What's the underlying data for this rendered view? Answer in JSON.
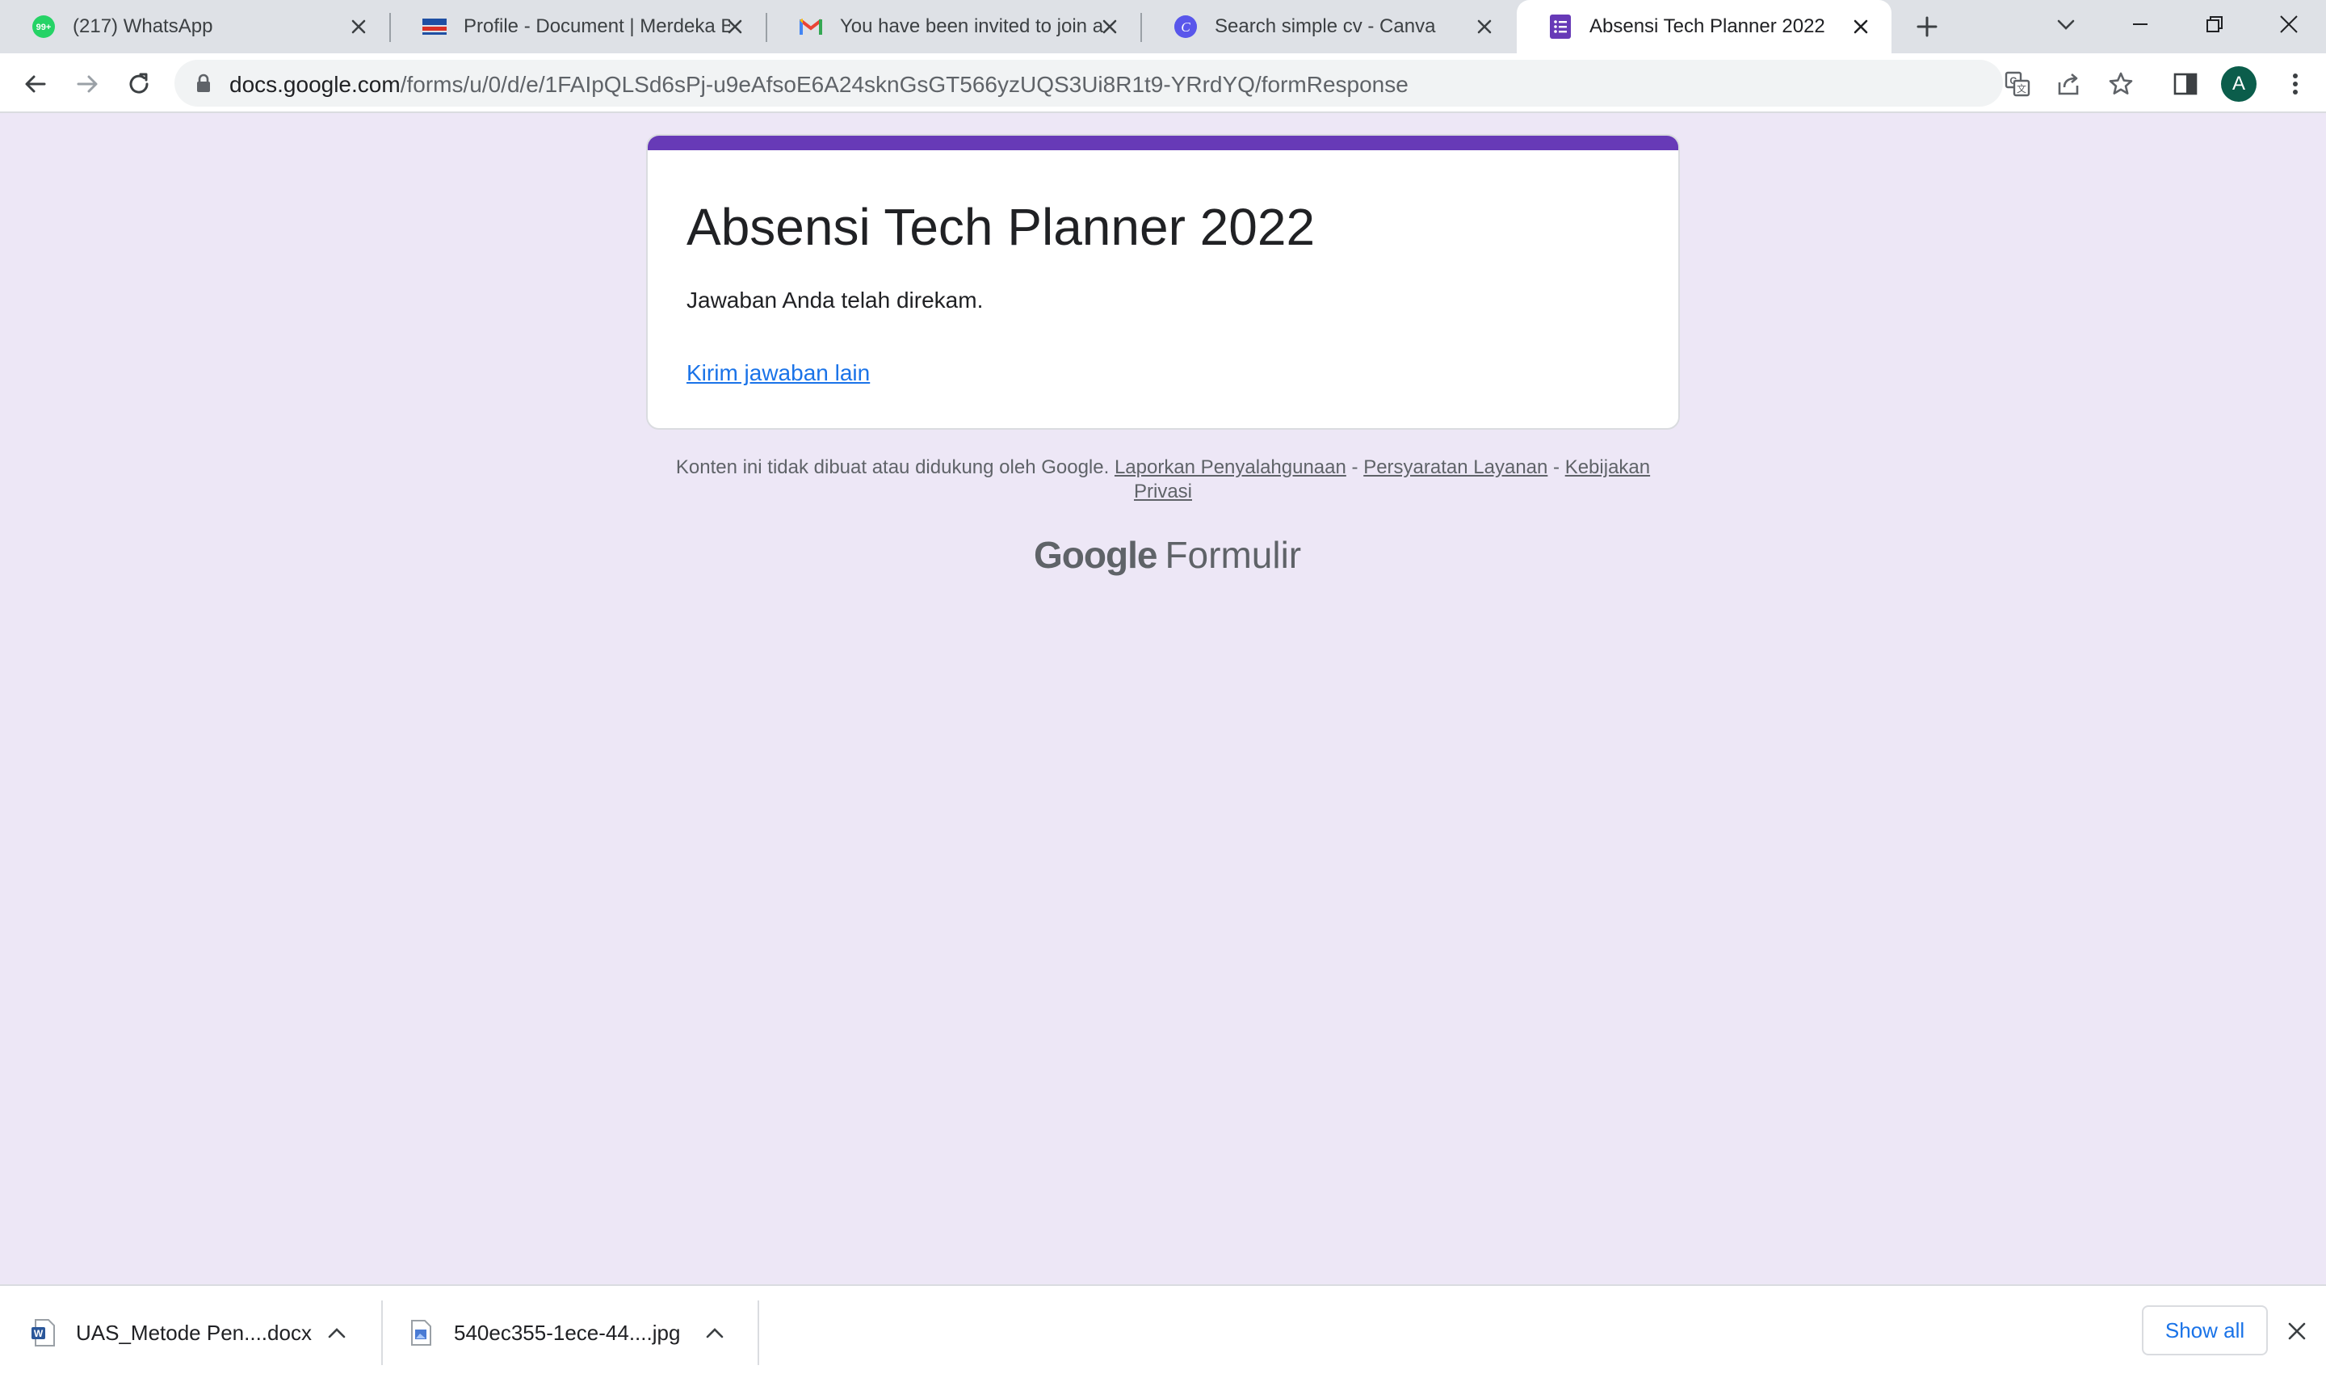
{
  "browser": {
    "tabs": [
      {
        "title": "(217) WhatsApp",
        "badge": "99+",
        "favicon": "whatsapp-icon",
        "active": false
      },
      {
        "title": "Profile - Document | Merdeka Belajar",
        "favicon": "merdeka-icon",
        "active": false
      },
      {
        "title": "You have been invited to join a",
        "favicon": "gmail-icon",
        "active": false
      },
      {
        "title": "Search simple cv - Canva",
        "favicon": "canva-icon",
        "active": false
      },
      {
        "title": "Absensi Tech Planner 2022",
        "favicon": "google-forms-icon",
        "active": true
      }
    ],
    "url": {
      "domain": "docs.google.com",
      "path": "/forms/u/0/d/e/1FAIpQLSd6sPj-u9eAfsoE6A24sknGsGT566yzUQS3Ui8R1t9-YRrdYQ/formResponse"
    },
    "profile_initial": "A",
    "colors": {
      "tabstrip": "#dee1e6",
      "avatar": "#0b5d4b"
    }
  },
  "form": {
    "title": "Absensi Tech Planner 2022",
    "confirmation": "Jawaban Anda telah direkam.",
    "another_response": "Kirim jawaban lain",
    "accent_color": "#673ab7",
    "background_color": "#ede7f6"
  },
  "footer": {
    "disclaimer": "Konten ini tidak dibuat atau didukung oleh Google.",
    "links": [
      "Laporkan Penyalahgunaan",
      "Persyaratan Layanan",
      "Kebijakan Privasi"
    ],
    "separator": "-",
    "brand_google": "Google",
    "brand_product": "Formulir"
  },
  "downloads": {
    "items": [
      {
        "name": "UAS_Metode Pen....docx",
        "icon": "word-doc-icon"
      },
      {
        "name": "540ec355-1ece-44....jpg",
        "icon": "image-file-icon"
      }
    ],
    "show_all": "Show all"
  }
}
